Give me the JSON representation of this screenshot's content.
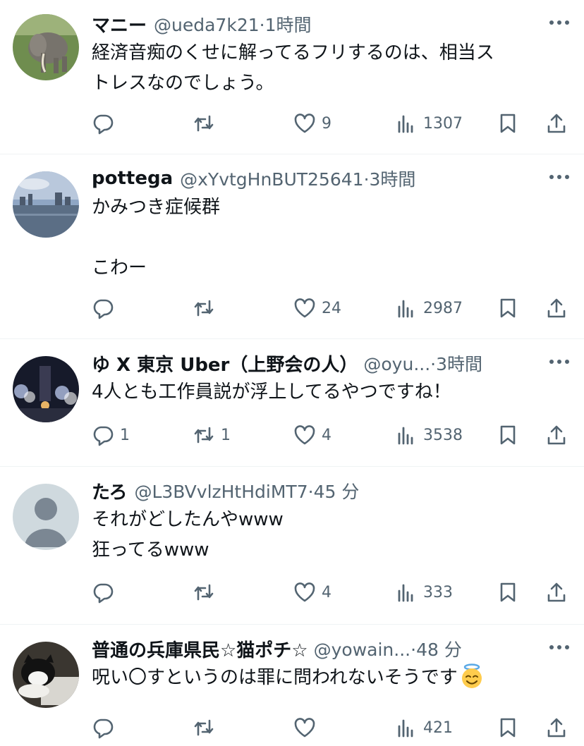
{
  "tweets": [
    {
      "name": "マニー",
      "handle": "@ueda7k21",
      "sep": "·",
      "time": "1時間",
      "text": "経済音痴のくせに解ってるフリするのは、相当ストレスなのでしょう。",
      "text_lines": [
        "経済音痴のくせに解ってるフリするのは、相当ス",
        "トレスなのでしょう。"
      ],
      "replies": "",
      "retweets": "",
      "likes": "9",
      "views": "1307",
      "avatar_icon": "elephant-avatar"
    },
    {
      "name": "pottega",
      "handle": "@xYvtgHnBUT25641",
      "sep": "·",
      "time": "3時間",
      "text_lines": [
        "かみつき症候群",
        "",
        "こわー"
      ],
      "replies": "",
      "retweets": "",
      "likes": "24",
      "views": "2987",
      "avatar_icon": "cityscape-avatar"
    },
    {
      "name": "ゆ X 東京 Uber（上野会の人）",
      "handle": "@oyu...",
      "sep": "·",
      "time": "3時間",
      "text_lines": [
        "4人とも工作員説が浮上してるやつですね！"
      ],
      "replies": "1",
      "retweets": "1",
      "likes": "4",
      "views": "3538",
      "avatar_icon": "night-lights-avatar"
    },
    {
      "name": "たろ",
      "handle": "@L3BVvlzHtHdiMT7",
      "sep": "·",
      "time": "45 分",
      "text_lines": [
        "それがどしたんやwww",
        "狂ってるwww"
      ],
      "replies": "",
      "retweets": "",
      "likes": "4",
      "views": "333",
      "avatar_icon": "default-person-avatar"
    },
    {
      "name": "普通の兵庫県民☆猫ポチ☆",
      "handle": "@yowain...",
      "sep": "·",
      "time": "48 分",
      "text_lines": [
        "呪い〇すというのは罪に問われないそうです"
      ],
      "emoji": "smiling-face-with-halo-emoji",
      "replies": "",
      "retweets": "",
      "likes": "",
      "views": "421",
      "avatar_icon": "cat-avatar"
    }
  ],
  "colors": {
    "text": "#0f1419",
    "secondary": "#536471",
    "divider": "#eff3f4",
    "background": "#ffffff"
  }
}
